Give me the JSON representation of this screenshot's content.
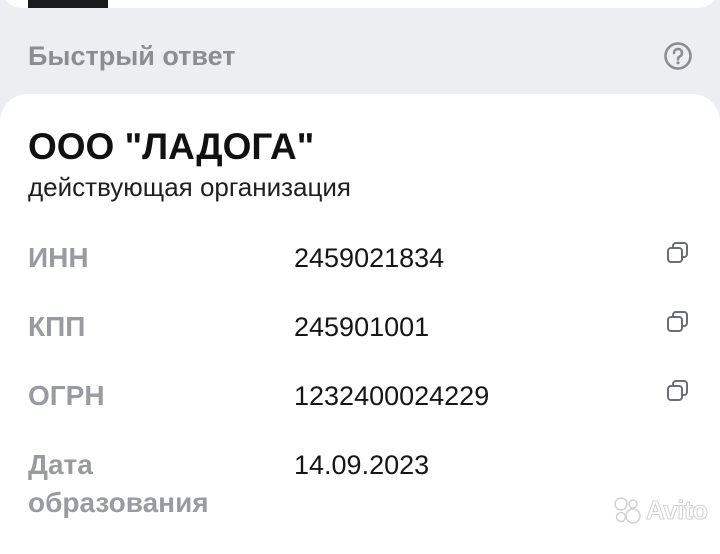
{
  "header": {
    "title": "Быстрый ответ",
    "help_icon": "question-circle-icon"
  },
  "organization": {
    "name": "ООО \"ЛАДОГА\"",
    "status": "действующая организация"
  },
  "fields": [
    {
      "label": "ИНН",
      "value": "2459021834",
      "copyable": true
    },
    {
      "label": "КПП",
      "value": "245901001",
      "copyable": true
    },
    {
      "label": "ОГРН",
      "value": "1232400024229",
      "copyable": true
    },
    {
      "label": "Дата образования",
      "value": "14.09.2023",
      "copyable": false
    }
  ],
  "watermark": {
    "text": "Avito"
  },
  "colors": {
    "background": "#edeef2",
    "card": "#ffffff",
    "label_gray": "#9a9ba1",
    "text_dark": "#111111"
  }
}
